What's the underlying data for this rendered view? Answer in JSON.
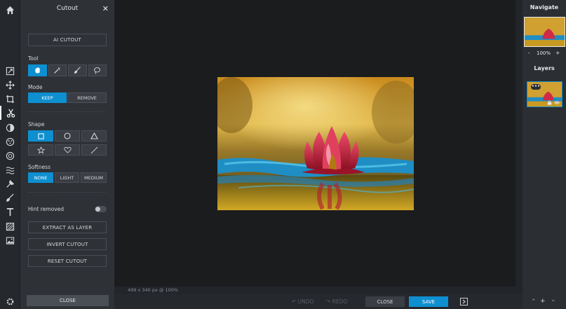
{
  "panel": {
    "title": "Cutout",
    "close_glyph": "✕",
    "ai_cutout_label": "AI CUTOUT",
    "tool_heading": "Tool",
    "tools": [
      "lasso-select",
      "magic-wand",
      "brush",
      "polygon-lasso"
    ],
    "mode_heading": "Mode",
    "modes": [
      {
        "label": "KEEP",
        "selected": true
      },
      {
        "label": "REMOVE",
        "selected": false
      }
    ],
    "shape_heading": "Shape",
    "shapes": [
      "rectangle",
      "ellipse",
      "triangle",
      "star",
      "heart",
      "line"
    ],
    "softness_heading": "Softness",
    "softness": [
      {
        "label": "NONE",
        "selected": true
      },
      {
        "label": "LIGHT",
        "selected": false
      },
      {
        "label": "MEDIUM",
        "selected": false
      }
    ],
    "hint_label": "Hint removed",
    "hint_on": false,
    "extract_label": "EXTRACT AS LAYER",
    "invert_label": "INVERT CUTOUT",
    "reset_label": "RESET CUTOUT",
    "footer_close_label": "CLOSE"
  },
  "toolbar": {
    "items": [
      "home",
      "transform",
      "move",
      "crop",
      "cutout",
      "adjust",
      "filter",
      "effect",
      "liquify",
      "clone-stamp",
      "draw",
      "text",
      "pattern",
      "image",
      "settings"
    ],
    "active": "cutout"
  },
  "canvas": {
    "status": "499 x 340 px @ 100%"
  },
  "bottom": {
    "undo_label": "UNDO",
    "redo_label": "REDO",
    "close_label": "CLOSE",
    "save_label": "SAVE"
  },
  "navigate": {
    "title": "Navigate",
    "zoom_minus": "-",
    "zoom": "100%",
    "zoom_plus": "+"
  },
  "layers": {
    "title": "Layers",
    "more_glyph": "•••"
  },
  "colors": {
    "accent": "#0e8fd0",
    "panel": "#2e3136",
    "canvas": "#1b1c1e"
  }
}
